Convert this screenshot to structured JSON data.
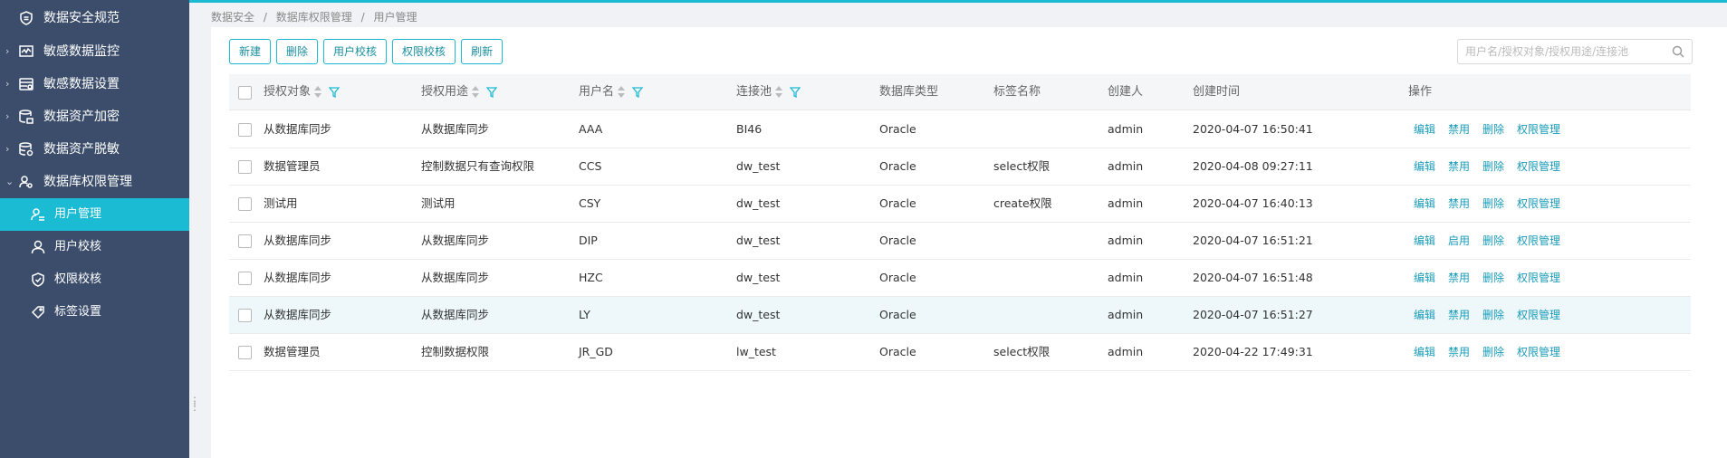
{
  "sidebar": {
    "items": [
      {
        "label": "数据安全规范",
        "icon": "shield-icon",
        "arrow": ""
      },
      {
        "label": "敏感数据监控",
        "icon": "monitor-chart-icon",
        "arrow": "›"
      },
      {
        "label": "敏感数据设置",
        "icon": "database-settings-icon",
        "arrow": "›"
      },
      {
        "label": "数据资产加密",
        "icon": "database-lock-icon",
        "arrow": "›"
      },
      {
        "label": "数据资产脱敏",
        "icon": "database-mask-icon",
        "arrow": "›"
      },
      {
        "label": "数据库权限管理",
        "icon": "user-key-icon",
        "arrow": "⌄"
      }
    ],
    "sub_items": [
      {
        "label": "用户管理",
        "icon": "user-list-icon",
        "active": true
      },
      {
        "label": "用户校核",
        "icon": "user-icon",
        "active": false
      },
      {
        "label": "权限校核",
        "icon": "shield-check-icon",
        "active": false
      },
      {
        "label": "标签设置",
        "icon": "tag-icon",
        "active": false
      }
    ]
  },
  "breadcrumb": [
    "数据安全",
    "/",
    "数据库权限管理",
    "/",
    "用户管理"
  ],
  "toolbar": {
    "new": "新建",
    "delete": "删除",
    "user_check": "用户校核",
    "perm_check": "权限校核",
    "refresh": "刷新"
  },
  "search": {
    "placeholder": "用户名/授权对象/授权用途/连接池",
    "value": ""
  },
  "table": {
    "headers": {
      "target": "授权对象",
      "purpose": "授权用途",
      "username": "用户名",
      "pool": "连接池",
      "dbtype": "数据库类型",
      "tag": "标签名称",
      "creator": "创建人",
      "created": "创建时间",
      "ops": "操作"
    },
    "rows": [
      {
        "target": "从数据库同步",
        "purpose": "从数据库同步",
        "username": "AAA",
        "pool": "BI46",
        "dbtype": "Oracle",
        "tag": "",
        "creator": "admin",
        "created": "2020-04-07 16:50:41",
        "ops": [
          "编辑",
          "禁用",
          "删除",
          "权限管理"
        ]
      },
      {
        "target": "数据管理员",
        "purpose": "控制数据只有查询权限",
        "username": "CCS",
        "pool": "dw_test",
        "dbtype": "Oracle",
        "tag": "select权限",
        "creator": "admin",
        "created": "2020-04-08 09:27:11",
        "ops": [
          "编辑",
          "禁用",
          "删除",
          "权限管理"
        ]
      },
      {
        "target": "测试用",
        "purpose": "测试用",
        "username": "CSY",
        "pool": "dw_test",
        "dbtype": "Oracle",
        "tag": "create权限",
        "creator": "admin",
        "created": "2020-04-07 16:40:13",
        "ops": [
          "编辑",
          "禁用",
          "删除",
          "权限管理"
        ]
      },
      {
        "target": "从数据库同步",
        "purpose": "从数据库同步",
        "username": "DIP",
        "pool": "dw_test",
        "dbtype": "Oracle",
        "tag": "",
        "creator": "admin",
        "created": "2020-04-07 16:51:21",
        "ops": [
          "编辑",
          "启用",
          "删除",
          "权限管理"
        ]
      },
      {
        "target": "从数据库同步",
        "purpose": "从数据库同步",
        "username": "HZC",
        "pool": "dw_test",
        "dbtype": "Oracle",
        "tag": "",
        "creator": "admin",
        "created": "2020-04-07 16:51:48",
        "ops": [
          "编辑",
          "禁用",
          "删除",
          "权限管理"
        ]
      },
      {
        "target": "从数据库同步",
        "purpose": "从数据库同步",
        "username": "LY",
        "pool": "dw_test",
        "dbtype": "Oracle",
        "tag": "",
        "creator": "admin",
        "created": "2020-04-07 16:51:27",
        "ops": [
          "编辑",
          "禁用",
          "删除",
          "权限管理"
        ],
        "highlighted": true
      },
      {
        "target": "数据管理员",
        "purpose": "控制数据权限",
        "username": "JR_GD",
        "pool": "lw_test",
        "dbtype": "Oracle",
        "tag": "select权限",
        "creator": "admin",
        "created": "2020-04-22 17:49:31",
        "ops": [
          "编辑",
          "禁用",
          "删除",
          "权限管理"
        ]
      }
    ]
  },
  "colors": {
    "accent": "#1cbbd4",
    "sidebar_bg": "#3b4d6b",
    "link": "#1a9bb8"
  }
}
